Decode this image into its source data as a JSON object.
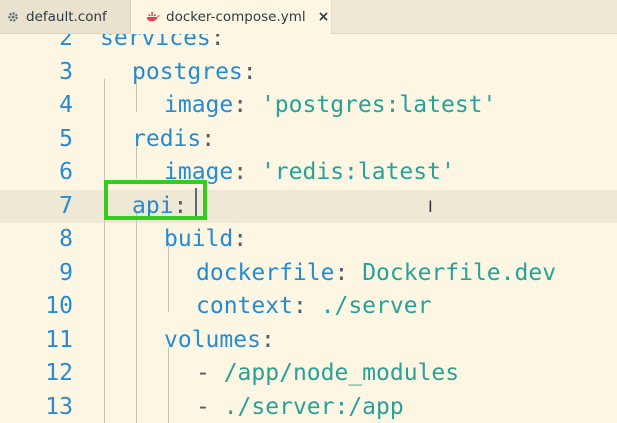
{
  "tabs": [
    {
      "label": "default.conf",
      "icon": "gear-icon",
      "active": false
    },
    {
      "label": "docker-compose.yml",
      "icon": "docker-whale-icon",
      "active": true,
      "close": "×"
    }
  ],
  "lines": [
    {
      "num": "2",
      "indent": 0,
      "tokens": [
        {
          "t": "services",
          "c": "k"
        },
        {
          "t": ":",
          "c": "p"
        }
      ]
    },
    {
      "num": "3",
      "indent": 1,
      "tokens": [
        {
          "t": "postgres",
          "c": "k"
        },
        {
          "t": ":",
          "c": "p"
        }
      ]
    },
    {
      "num": "4",
      "indent": 2,
      "tokens": [
        {
          "t": "image",
          "c": "k"
        },
        {
          "t": ": ",
          "c": "p"
        },
        {
          "t": "'postgres:latest'",
          "c": "s"
        }
      ]
    },
    {
      "num": "5",
      "indent": 1,
      "tokens": [
        {
          "t": "redis",
          "c": "k"
        },
        {
          "t": ":",
          "c": "p"
        }
      ]
    },
    {
      "num": "6",
      "indent": 2,
      "tokens": [
        {
          "t": "image",
          "c": "k"
        },
        {
          "t": ": ",
          "c": "p"
        },
        {
          "t": "'redis:latest'",
          "c": "s"
        }
      ]
    },
    {
      "num": "7",
      "indent": 1,
      "tokens": [
        {
          "t": "api",
          "c": "k"
        },
        {
          "t": ":",
          "c": "p"
        }
      ],
      "current": true
    },
    {
      "num": "8",
      "indent": 2,
      "tokens": [
        {
          "t": "build",
          "c": "k"
        },
        {
          "t": ":",
          "c": "p"
        }
      ]
    },
    {
      "num": "9",
      "indent": 3,
      "tokens": [
        {
          "t": "dockerfile",
          "c": "k"
        },
        {
          "t": ": ",
          "c": "p"
        },
        {
          "t": "Dockerfile.dev",
          "c": "s"
        }
      ]
    },
    {
      "num": "10",
      "indent": 3,
      "tokens": [
        {
          "t": "context",
          "c": "k"
        },
        {
          "t": ": ",
          "c": "p"
        },
        {
          "t": "./server",
          "c": "s"
        }
      ]
    },
    {
      "num": "11",
      "indent": 2,
      "tokens": [
        {
          "t": "volumes",
          "c": "k"
        },
        {
          "t": ":",
          "c": "p"
        }
      ]
    },
    {
      "num": "12",
      "indent": 3,
      "tokens": [
        {
          "t": "- ",
          "c": "p"
        },
        {
          "t": "/app/node_modules",
          "c": "s"
        }
      ]
    },
    {
      "num": "13",
      "indent": 3,
      "tokens": [
        {
          "t": "- ",
          "c": "p"
        },
        {
          "t": "./server:/app",
          "c": "s"
        }
      ]
    }
  ],
  "colors": {
    "background": "#fdf6e3",
    "keyword": "#268bd2",
    "string": "#2aa198",
    "highlight_box": "#33cc1f"
  }
}
